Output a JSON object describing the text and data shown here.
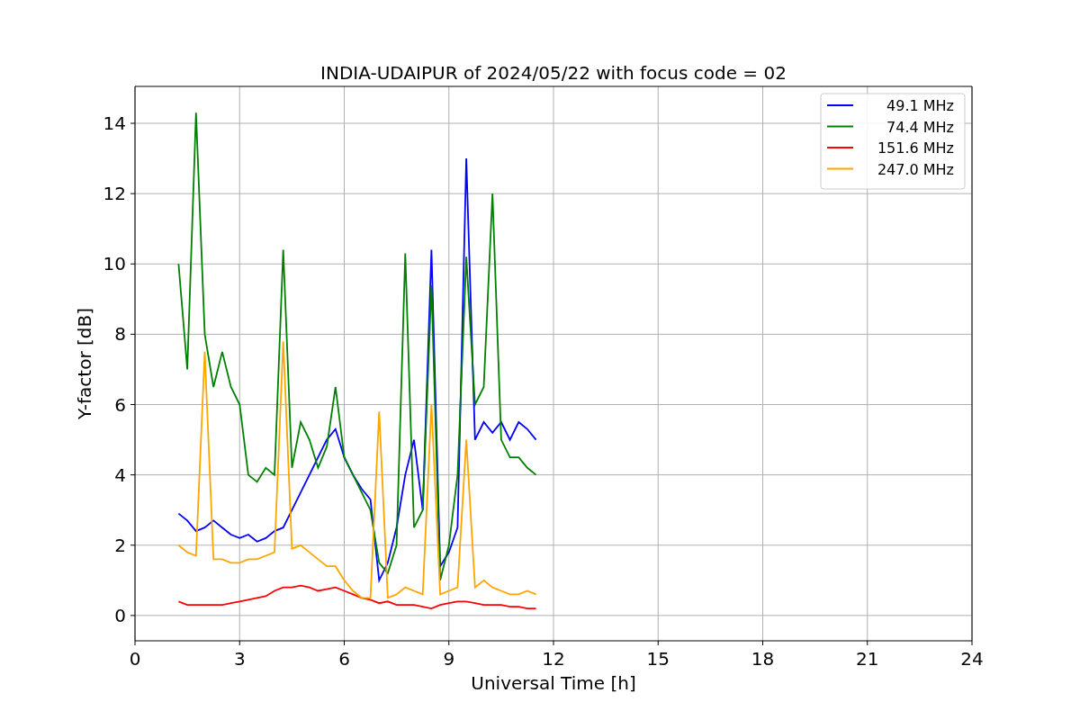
{
  "figure": {
    "chart_data": {
      "type": "line",
      "title": "INDIA-UDAIPUR of 2024/05/22 with focus code = 02",
      "xlabel": "Universal Time [h]",
      "ylabel": "Y-factor [dB]",
      "x": [
        1.25,
        1.5,
        1.75,
        2.0,
        2.25,
        2.5,
        2.75,
        3.0,
        3.25,
        3.5,
        3.75,
        4.0,
        4.25,
        4.5,
        4.75,
        5.0,
        5.25,
        5.5,
        5.75,
        6.0,
        6.25,
        6.5,
        6.75,
        7.0,
        7.25,
        7.5,
        7.75,
        8.0,
        8.25,
        8.5,
        8.75,
        9.0,
        9.25,
        9.5,
        9.75,
        10.0,
        10.25,
        10.5,
        10.75,
        11.0,
        11.25,
        11.5
      ],
      "series": [
        {
          "name": "49.1 MHz",
          "color": "#0000ff",
          "values": [
            2.9,
            2.7,
            2.4,
            2.5,
            2.7,
            2.5,
            2.3,
            2.2,
            2.3,
            2.1,
            2.2,
            2.4,
            2.5,
            3.0,
            3.5,
            4.0,
            4.5,
            5.0,
            5.3,
            4.5,
            4.0,
            3.6,
            3.3,
            1.0,
            1.5,
            2.5,
            4.0,
            5.0,
            3.0,
            10.4,
            1.4,
            1.8,
            2.5,
            13.0,
            5.0,
            5.5,
            5.2,
            5.5,
            5.0,
            5.5,
            5.3,
            5.0
          ]
        },
        {
          "name": "74.4 MHz",
          "color": "#008000",
          "values": [
            10.0,
            7.0,
            14.3,
            8.0,
            6.5,
            7.5,
            6.5,
            6.0,
            4.0,
            3.8,
            4.2,
            4.0,
            10.4,
            4.2,
            5.5,
            5.0,
            4.2,
            4.8,
            6.5,
            4.5,
            4.0,
            3.5,
            3.0,
            1.5,
            1.2,
            2.0,
            10.3,
            2.5,
            3.0,
            9.4,
            1.0,
            2.0,
            4.0,
            10.2,
            6.0,
            6.5,
            12.0,
            5.0,
            4.5,
            4.5,
            4.2,
            4.0
          ]
        },
        {
          "name": "151.6 MHz",
          "color": "#ff0000",
          "values": [
            0.4,
            0.3,
            0.3,
            0.3,
            0.3,
            0.3,
            0.35,
            0.4,
            0.45,
            0.5,
            0.55,
            0.7,
            0.8,
            0.8,
            0.85,
            0.8,
            0.7,
            0.75,
            0.8,
            0.7,
            0.6,
            0.5,
            0.45,
            0.35,
            0.4,
            0.3,
            0.3,
            0.3,
            0.25,
            0.2,
            0.3,
            0.35,
            0.4,
            0.4,
            0.35,
            0.3,
            0.3,
            0.3,
            0.25,
            0.25,
            0.2,
            0.2
          ]
        },
        {
          "name": "247.0 MHz",
          "color": "#ffa500",
          "values": [
            2.0,
            1.8,
            1.7,
            7.5,
            1.6,
            1.6,
            1.5,
            1.5,
            1.6,
            1.6,
            1.7,
            1.8,
            7.8,
            1.9,
            2.0,
            1.8,
            1.6,
            1.4,
            1.4,
            1.0,
            0.7,
            0.5,
            0.5,
            5.8,
            0.5,
            0.6,
            0.8,
            0.7,
            0.6,
            6.0,
            0.6,
            0.7,
            0.8,
            5.0,
            0.8,
            1.0,
            0.8,
            0.7,
            0.6,
            0.6,
            0.7,
            0.6
          ]
        }
      ],
      "grid": true,
      "legend": true,
      "xlim": [
        0,
        24
      ],
      "ylim": [
        -0.72,
        15.05
      ],
      "xticks": [
        0,
        3,
        6,
        9,
        12,
        15,
        18,
        21,
        24
      ],
      "yticks": [
        0,
        2,
        4,
        6,
        8,
        10,
        12,
        14
      ]
    }
  }
}
